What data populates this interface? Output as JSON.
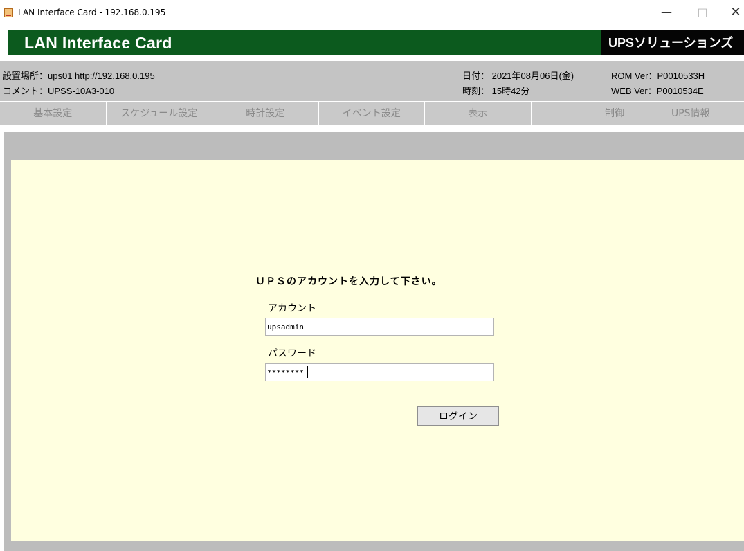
{
  "window": {
    "title": "LAN Interface Card - 192.168.0.195",
    "icon": "java-coffee-icon",
    "minimize": "—",
    "maximize": "□",
    "close": "✕"
  },
  "banner": {
    "brand": "LAN Interface Card",
    "maker": "UPSソリューションズ",
    "color": "#0c5a1e"
  },
  "info": {
    "location": "設置場所：ups01 http://192.168.0.195",
    "comment": "コメント：UPSS-10A3-010",
    "date": "日付： 2021年08月06日(金)",
    "time": "時刻： 15時42分",
    "rom_ver": "ROM Ver：P0010533H",
    "web_ver": "WEB Ver：P0010534E"
  },
  "menu": [
    "基本設定",
    "スケジュール設定",
    "時計設定",
    "イベント設定",
    "表示",
    "制御",
    "UPS情報"
  ],
  "login": {
    "prompt": "ＵＰＳのアカウントを入力して下さい。",
    "account_label": "アカウント",
    "account_value": "upsadmin",
    "password_label": "パスワード",
    "password_value": "********",
    "button": "ログイン"
  }
}
